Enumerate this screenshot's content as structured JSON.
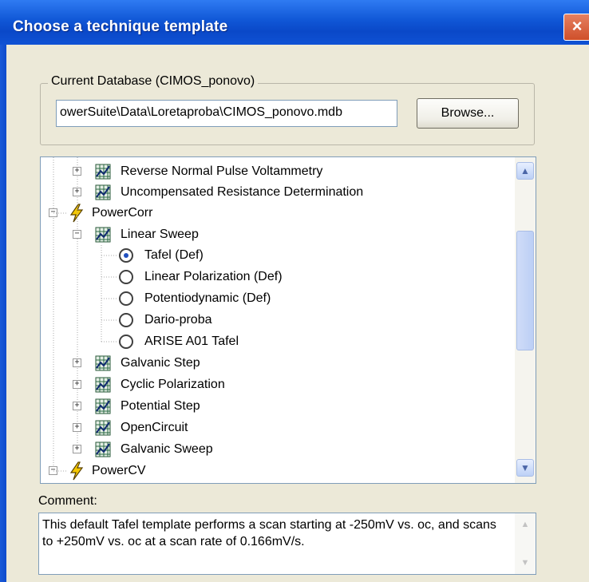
{
  "window": {
    "title": "Choose a technique template",
    "close_label": "×"
  },
  "database": {
    "group_label": "Current Database (CIMOS_ponovo)",
    "path_value": "owerSuite\\Data\\Loretaproba\\CIMOS_ponovo.mdb",
    "browse_label": "Browse..."
  },
  "tree": {
    "items": [
      {
        "label": "Reverse Normal Pulse Voltammetry",
        "type": "technique",
        "expander": "+"
      },
      {
        "label": "Uncompensated Resistance Determination",
        "type": "technique",
        "expander": "+"
      },
      {
        "label": "PowerCorr",
        "type": "group",
        "expander": "−"
      },
      {
        "label": "Linear Sweep",
        "type": "technique",
        "expander": "−"
      },
      {
        "label": "Tafel (Def)",
        "type": "template",
        "selected": true
      },
      {
        "label": "Linear Polarization (Def)",
        "type": "template"
      },
      {
        "label": "Potentiodynamic (Def)",
        "type": "template"
      },
      {
        "label": "Dario-proba",
        "type": "template"
      },
      {
        "label": "ARISE A01 Tafel",
        "type": "template"
      },
      {
        "label": "Galvanic Step",
        "type": "technique",
        "expander": "+"
      },
      {
        "label": "Cyclic Polarization",
        "type": "technique",
        "expander": "+"
      },
      {
        "label": "Potential Step",
        "type": "technique",
        "expander": "+"
      },
      {
        "label": "OpenCircuit",
        "type": "technique",
        "expander": "+"
      },
      {
        "label": "Galvanic Sweep",
        "type": "technique",
        "expander": "+"
      },
      {
        "label": "PowerCV",
        "type": "group",
        "expander": "−"
      }
    ],
    "scroll_up": "▲",
    "scroll_down": "▼"
  },
  "comment": {
    "label": "Comment:",
    "text": "This default Tafel template performs a scan starting at -250mV vs. oc, and scans to +250mV vs. oc at a scan rate of 0.166mV/s.",
    "scroll_up": "▲",
    "scroll_down": "▼"
  },
  "colors": {
    "titlebar": "#0a48c8",
    "dialog_bg": "#ece9d8",
    "selection_dot": "#2050c0",
    "bolt": "#f5c800"
  }
}
